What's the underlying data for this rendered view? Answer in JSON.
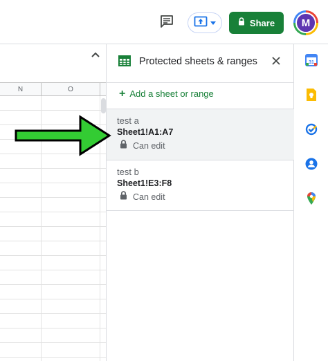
{
  "toolbar": {
    "icons": [
      "comment-icon",
      "present-icon",
      "chevron-down-icon",
      "lock-icon"
    ],
    "share_label": "Share",
    "avatar_initial": "M",
    "colors": {
      "share_bg": "#188038",
      "avatar_bg": "#5e35b1"
    }
  },
  "sheet": {
    "columns": [
      "N",
      "O"
    ]
  },
  "panel": {
    "title": "Protected sheets & ranges",
    "add_label": "Add a sheet or range",
    "items": [
      {
        "description": "test a",
        "range": "Sheet1!A1:A7",
        "permission": "Can edit",
        "selected": true
      },
      {
        "description": "test b",
        "range": "Sheet1!E3:F8",
        "permission": "Can edit",
        "selected": false
      }
    ]
  },
  "rail": {
    "icons": [
      "calendar-icon",
      "keep-icon",
      "tasks-icon",
      "contacts-icon",
      "maps-icon"
    ]
  },
  "annotation": {
    "type": "green-arrow",
    "points_to": "test a",
    "color": "#33cc33"
  }
}
